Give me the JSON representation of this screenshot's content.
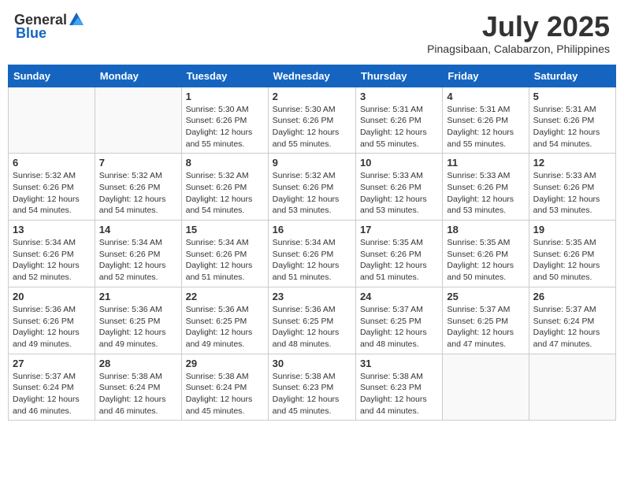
{
  "logo": {
    "general": "General",
    "blue": "Blue"
  },
  "title": "July 2025",
  "location": "Pinagsibaan, Calabarzon, Philippines",
  "weekdays": [
    "Sunday",
    "Monday",
    "Tuesday",
    "Wednesday",
    "Thursday",
    "Friday",
    "Saturday"
  ],
  "weeks": [
    [
      {
        "day": "",
        "info": ""
      },
      {
        "day": "",
        "info": ""
      },
      {
        "day": "1",
        "info": "Sunrise: 5:30 AM\nSunset: 6:26 PM\nDaylight: 12 hours\nand 55 minutes."
      },
      {
        "day": "2",
        "info": "Sunrise: 5:30 AM\nSunset: 6:26 PM\nDaylight: 12 hours\nand 55 minutes."
      },
      {
        "day": "3",
        "info": "Sunrise: 5:31 AM\nSunset: 6:26 PM\nDaylight: 12 hours\nand 55 minutes."
      },
      {
        "day": "4",
        "info": "Sunrise: 5:31 AM\nSunset: 6:26 PM\nDaylight: 12 hours\nand 55 minutes."
      },
      {
        "day": "5",
        "info": "Sunrise: 5:31 AM\nSunset: 6:26 PM\nDaylight: 12 hours\nand 54 minutes."
      }
    ],
    [
      {
        "day": "6",
        "info": "Sunrise: 5:32 AM\nSunset: 6:26 PM\nDaylight: 12 hours\nand 54 minutes."
      },
      {
        "day": "7",
        "info": "Sunrise: 5:32 AM\nSunset: 6:26 PM\nDaylight: 12 hours\nand 54 minutes."
      },
      {
        "day": "8",
        "info": "Sunrise: 5:32 AM\nSunset: 6:26 PM\nDaylight: 12 hours\nand 54 minutes."
      },
      {
        "day": "9",
        "info": "Sunrise: 5:32 AM\nSunset: 6:26 PM\nDaylight: 12 hours\nand 53 minutes."
      },
      {
        "day": "10",
        "info": "Sunrise: 5:33 AM\nSunset: 6:26 PM\nDaylight: 12 hours\nand 53 minutes."
      },
      {
        "day": "11",
        "info": "Sunrise: 5:33 AM\nSunset: 6:26 PM\nDaylight: 12 hours\nand 53 minutes."
      },
      {
        "day": "12",
        "info": "Sunrise: 5:33 AM\nSunset: 6:26 PM\nDaylight: 12 hours\nand 53 minutes."
      }
    ],
    [
      {
        "day": "13",
        "info": "Sunrise: 5:34 AM\nSunset: 6:26 PM\nDaylight: 12 hours\nand 52 minutes."
      },
      {
        "day": "14",
        "info": "Sunrise: 5:34 AM\nSunset: 6:26 PM\nDaylight: 12 hours\nand 52 minutes."
      },
      {
        "day": "15",
        "info": "Sunrise: 5:34 AM\nSunset: 6:26 PM\nDaylight: 12 hours\nand 51 minutes."
      },
      {
        "day": "16",
        "info": "Sunrise: 5:34 AM\nSunset: 6:26 PM\nDaylight: 12 hours\nand 51 minutes."
      },
      {
        "day": "17",
        "info": "Sunrise: 5:35 AM\nSunset: 6:26 PM\nDaylight: 12 hours\nand 51 minutes."
      },
      {
        "day": "18",
        "info": "Sunrise: 5:35 AM\nSunset: 6:26 PM\nDaylight: 12 hours\nand 50 minutes."
      },
      {
        "day": "19",
        "info": "Sunrise: 5:35 AM\nSunset: 6:26 PM\nDaylight: 12 hours\nand 50 minutes."
      }
    ],
    [
      {
        "day": "20",
        "info": "Sunrise: 5:36 AM\nSunset: 6:26 PM\nDaylight: 12 hours\nand 49 minutes."
      },
      {
        "day": "21",
        "info": "Sunrise: 5:36 AM\nSunset: 6:25 PM\nDaylight: 12 hours\nand 49 minutes."
      },
      {
        "day": "22",
        "info": "Sunrise: 5:36 AM\nSunset: 6:25 PM\nDaylight: 12 hours\nand 49 minutes."
      },
      {
        "day": "23",
        "info": "Sunrise: 5:36 AM\nSunset: 6:25 PM\nDaylight: 12 hours\nand 48 minutes."
      },
      {
        "day": "24",
        "info": "Sunrise: 5:37 AM\nSunset: 6:25 PM\nDaylight: 12 hours\nand 48 minutes."
      },
      {
        "day": "25",
        "info": "Sunrise: 5:37 AM\nSunset: 6:25 PM\nDaylight: 12 hours\nand 47 minutes."
      },
      {
        "day": "26",
        "info": "Sunrise: 5:37 AM\nSunset: 6:24 PM\nDaylight: 12 hours\nand 47 minutes."
      }
    ],
    [
      {
        "day": "27",
        "info": "Sunrise: 5:37 AM\nSunset: 6:24 PM\nDaylight: 12 hours\nand 46 minutes."
      },
      {
        "day": "28",
        "info": "Sunrise: 5:38 AM\nSunset: 6:24 PM\nDaylight: 12 hours\nand 46 minutes."
      },
      {
        "day": "29",
        "info": "Sunrise: 5:38 AM\nSunset: 6:24 PM\nDaylight: 12 hours\nand 45 minutes."
      },
      {
        "day": "30",
        "info": "Sunrise: 5:38 AM\nSunset: 6:23 PM\nDaylight: 12 hours\nand 45 minutes."
      },
      {
        "day": "31",
        "info": "Sunrise: 5:38 AM\nSunset: 6:23 PM\nDaylight: 12 hours\nand 44 minutes."
      },
      {
        "day": "",
        "info": ""
      },
      {
        "day": "",
        "info": ""
      }
    ]
  ]
}
